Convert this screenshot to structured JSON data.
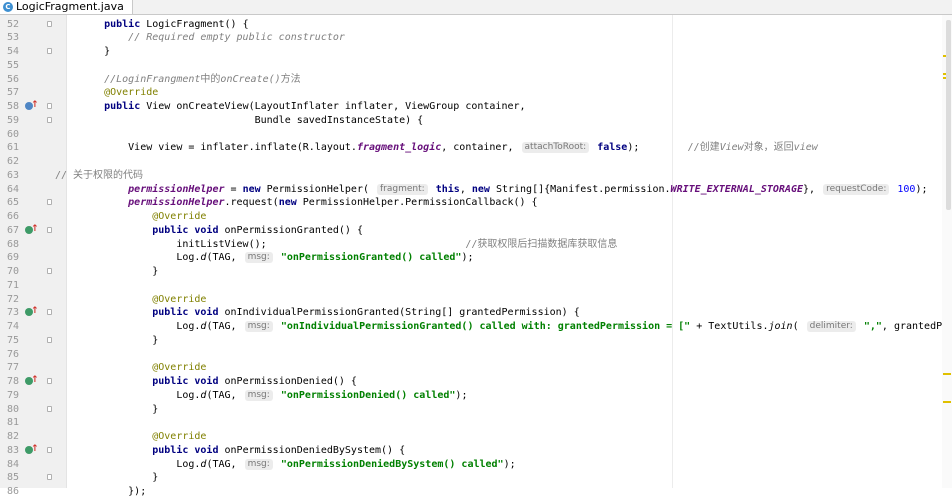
{
  "tab": {
    "icon": "C",
    "label": "LogicFragment.java"
  },
  "lines": [
    {
      "num": "52",
      "fold": true,
      "segs": [
        {
          "t": "    "
        },
        {
          "t": "public",
          "c": "kw"
        },
        {
          "t": " LogicFragment() {"
        }
      ]
    },
    {
      "num": "53",
      "fold": false,
      "segs": [
        {
          "t": "        "
        },
        {
          "t": "// Required empty public constructor",
          "c": "cm"
        }
      ]
    },
    {
      "num": "54",
      "fold": true,
      "segs": [
        {
          "t": "    }"
        }
      ]
    },
    {
      "num": "55",
      "fold": false,
      "segs": [
        {
          "t": ""
        }
      ]
    },
    {
      "num": "56",
      "fold": false,
      "segs": [
        {
          "t": "    "
        },
        {
          "t": "//LoginFrangment",
          "c": "cm"
        },
        {
          "t": "中的",
          "c": "cmz"
        },
        {
          "t": "onCreate()",
          "c": "cm"
        },
        {
          "t": "方法",
          "c": "cmz"
        }
      ]
    },
    {
      "num": "57",
      "fold": false,
      "segs": [
        {
          "t": "    "
        },
        {
          "t": "@Override",
          "c": "an"
        }
      ]
    },
    {
      "num": "58",
      "fold": true,
      "icon": "ovr",
      "segs": [
        {
          "t": "    "
        },
        {
          "t": "public",
          "c": "kw"
        },
        {
          "t": " View onCreateView(LayoutInflater inflater, ViewGroup container,"
        }
      ]
    },
    {
      "num": "59",
      "fold": true,
      "segs": [
        {
          "t": "                             Bundle savedInstanceState) {"
        }
      ]
    },
    {
      "num": "60",
      "fold": false,
      "segs": [
        {
          "t": ""
        }
      ]
    },
    {
      "num": "61",
      "fold": false,
      "segs": [
        {
          "t": "        View view = inflater.inflate(R.layout."
        },
        {
          "t": "fragment_logic",
          "c": "fi"
        },
        {
          "t": ", container, "
        },
        {
          "t": "attachToRoot:",
          "c": "hint"
        },
        {
          "t": " "
        },
        {
          "t": "false",
          "c": "kw"
        },
        {
          "t": ");        "
        },
        {
          "t": "//创建",
          "c": "cmz"
        },
        {
          "t": "View",
          "c": "cm"
        },
        {
          "t": "对象，返回",
          "c": "cmz"
        },
        {
          "t": "view",
          "c": "cm"
        }
      ]
    },
    {
      "num": "62",
      "fold": false,
      "segs": [
        {
          "t": ""
        }
      ]
    },
    {
      "num": "63",
      "fold": false,
      "segs": [
        {
          "t": "// 关于权限的代码",
          "c": "cmz",
          "x": -25
        }
      ]
    },
    {
      "num": "64",
      "fold": false,
      "segs": [
        {
          "t": "        permissionHelper",
          "c": "fi"
        },
        {
          "t": " = "
        },
        {
          "t": "new",
          "c": "kw"
        },
        {
          "t": " PermissionHelper( "
        },
        {
          "t": "fragment:",
          "c": "hint"
        },
        {
          "t": " "
        },
        {
          "t": "this",
          "c": "kw"
        },
        {
          "t": ", "
        },
        {
          "t": "new",
          "c": "kw"
        },
        {
          "t": " String[]{Manifest.permission."
        },
        {
          "t": "WRITE_EXTERNAL_STORAGE",
          "c": "fi"
        },
        {
          "t": "}, "
        },
        {
          "t": "requestCode:",
          "c": "hint"
        },
        {
          "t": " "
        },
        {
          "t": "100",
          "c": "nm"
        },
        {
          "t": ");"
        }
      ]
    },
    {
      "num": "65",
      "fold": true,
      "segs": [
        {
          "t": "        permissionHelper",
          "c": "fi"
        },
        {
          "t": ".request("
        },
        {
          "t": "new",
          "c": "kw"
        },
        {
          "t": " PermissionHelper.PermissionCallback() {"
        }
      ]
    },
    {
      "num": "66",
      "fold": false,
      "segs": [
        {
          "t": "            "
        },
        {
          "t": "@Override",
          "c": "an"
        }
      ]
    },
    {
      "num": "67",
      "fold": true,
      "icon": "impl",
      "segs": [
        {
          "t": "            "
        },
        {
          "t": "public void",
          "c": "kw"
        },
        {
          "t": " onPermissionGranted() {"
        }
      ]
    },
    {
      "num": "68",
      "fold": false,
      "segs": [
        {
          "t": "                initListView();                                 "
        },
        {
          "t": "//获取权限后扫描数据库获取信息",
          "c": "cmz"
        }
      ]
    },
    {
      "num": "69",
      "fold": false,
      "segs": [
        {
          "t": "                Log."
        },
        {
          "t": "d",
          "c": "it"
        },
        {
          "t": "(TAG, "
        },
        {
          "t": "msg:",
          "c": "hint"
        },
        {
          "t": " "
        },
        {
          "t": "\"onPermissionGranted() called\"",
          "c": "st"
        },
        {
          "t": ");"
        }
      ]
    },
    {
      "num": "70",
      "fold": true,
      "segs": [
        {
          "t": "            }"
        }
      ]
    },
    {
      "num": "71",
      "fold": false,
      "segs": [
        {
          "t": ""
        }
      ]
    },
    {
      "num": "72",
      "fold": false,
      "segs": [
        {
          "t": "            "
        },
        {
          "t": "@Override",
          "c": "an"
        }
      ]
    },
    {
      "num": "73",
      "fold": true,
      "icon": "impl",
      "segs": [
        {
          "t": "            "
        },
        {
          "t": "public void",
          "c": "kw"
        },
        {
          "t": " onIndividualPermissionGranted(String[] grantedPermission) {"
        }
      ]
    },
    {
      "num": "74",
      "fold": false,
      "segs": [
        {
          "t": "                Log."
        },
        {
          "t": "d",
          "c": "it"
        },
        {
          "t": "(TAG, "
        },
        {
          "t": "msg:",
          "c": "hint"
        },
        {
          "t": " "
        },
        {
          "t": "\"onIndividualPermissionGranted() called with: grantedPermission = [\"",
          "c": "st"
        },
        {
          "t": " + TextUtils."
        },
        {
          "t": "join",
          "c": "it"
        },
        {
          "t": "( "
        },
        {
          "t": "delimiter:",
          "c": "hint"
        },
        {
          "t": " "
        },
        {
          "t": "\",\"",
          "c": "st"
        },
        {
          "t": ", grantedPermi"
        }
      ]
    },
    {
      "num": "75",
      "fold": true,
      "segs": [
        {
          "t": "            }"
        }
      ]
    },
    {
      "num": "76",
      "fold": false,
      "segs": [
        {
          "t": ""
        }
      ]
    },
    {
      "num": "77",
      "fold": false,
      "segs": [
        {
          "t": "            "
        },
        {
          "t": "@Override",
          "c": "an"
        }
      ]
    },
    {
      "num": "78",
      "fold": true,
      "icon": "impl",
      "segs": [
        {
          "t": "            "
        },
        {
          "t": "public void",
          "c": "kw"
        },
        {
          "t": " onPermissionDenied() {"
        }
      ]
    },
    {
      "num": "79",
      "fold": false,
      "segs": [
        {
          "t": "                Log."
        },
        {
          "t": "d",
          "c": "it"
        },
        {
          "t": "(TAG, "
        },
        {
          "t": "msg:",
          "c": "hint"
        },
        {
          "t": " "
        },
        {
          "t": "\"onPermissionDenied() called\"",
          "c": "st"
        },
        {
          "t": ");"
        }
      ]
    },
    {
      "num": "80",
      "fold": true,
      "segs": [
        {
          "t": "            }"
        }
      ]
    },
    {
      "num": "81",
      "fold": false,
      "segs": [
        {
          "t": ""
        }
      ]
    },
    {
      "num": "82",
      "fold": false,
      "segs": [
        {
          "t": "            "
        },
        {
          "t": "@Override",
          "c": "an"
        }
      ]
    },
    {
      "num": "83",
      "fold": true,
      "icon": "impl",
      "segs": [
        {
          "t": "            "
        },
        {
          "t": "public void",
          "c": "kw"
        },
        {
          "t": " onPermissionDeniedBySystem() {"
        }
      ]
    },
    {
      "num": "84",
      "fold": false,
      "segs": [
        {
          "t": "                Log."
        },
        {
          "t": "d",
          "c": "it"
        },
        {
          "t": "(TAG, "
        },
        {
          "t": "msg:",
          "c": "hint"
        },
        {
          "t": " "
        },
        {
          "t": "\"onPermissionDeniedBySystem() called\"",
          "c": "st"
        },
        {
          "t": ");"
        }
      ]
    },
    {
      "num": "85",
      "fold": true,
      "segs": [
        {
          "t": "            }"
        }
      ]
    },
    {
      "num": "86",
      "fold": false,
      "segs": [
        {
          "t": "        });"
        }
      ]
    }
  ],
  "icons": {
    "override_marker": "override-method-icon",
    "implement_marker": "implement-method-icon",
    "fold_marker": "fold-marker-icon"
  },
  "colors": {
    "keyword": "#000080",
    "comment": "#808080",
    "annotation": "#808000",
    "string": "#008000",
    "field": "#660e7a",
    "number": "#0000ff"
  }
}
